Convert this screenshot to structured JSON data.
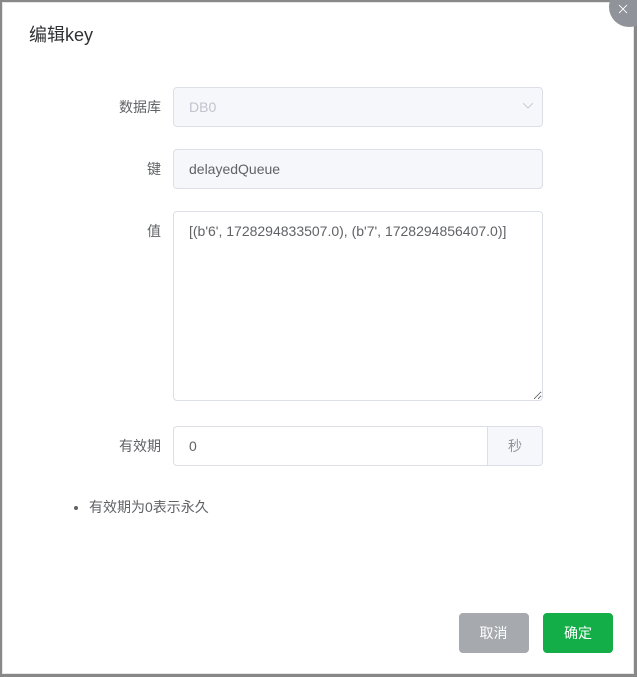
{
  "dialog": {
    "title": "编辑key"
  },
  "form": {
    "database": {
      "label": "数据库",
      "value": "DB0"
    },
    "key": {
      "label": "键",
      "value": "delayedQueue"
    },
    "value": {
      "label": "值",
      "value": "[(b'6', 1728294833507.0), (b'7', 1728294856407.0)]"
    },
    "ttl": {
      "label": "有效期",
      "value": "0",
      "unit": "秒"
    }
  },
  "hint": "有效期为0表示永久",
  "footer": {
    "cancel": "取消",
    "confirm": "确定"
  }
}
